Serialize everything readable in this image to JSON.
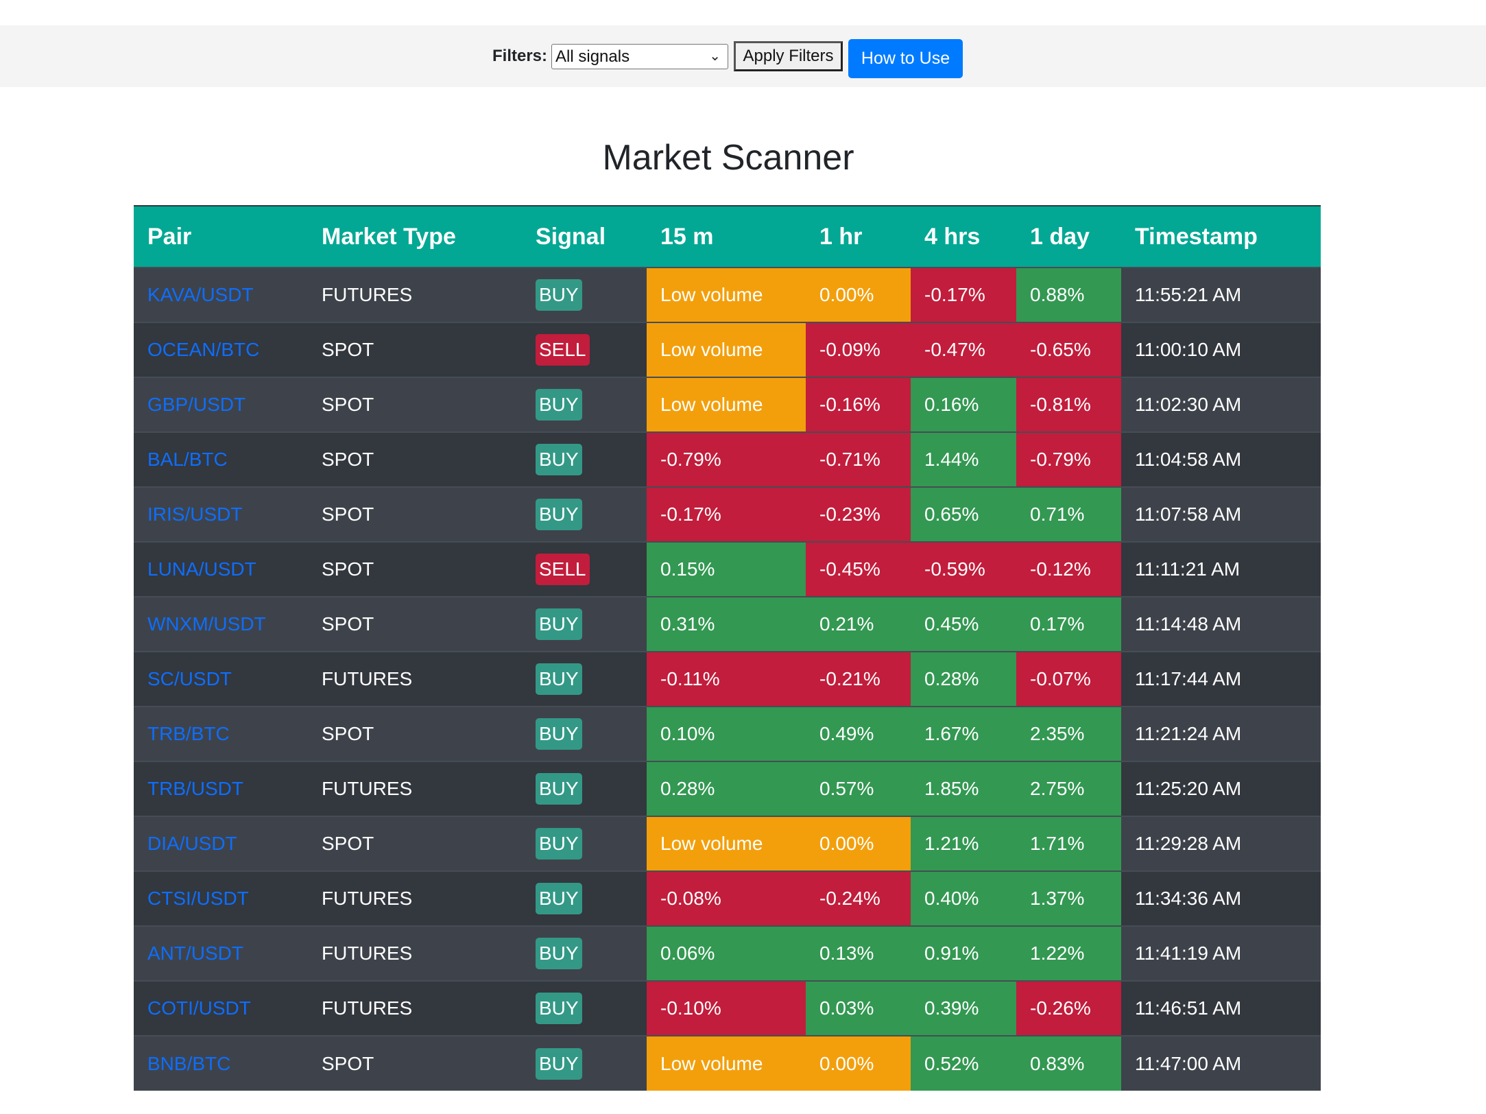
{
  "filter_bar": {
    "label": "Filters:",
    "select_value": "All signals",
    "apply_label": "Apply Filters",
    "howto_label": "How to Use"
  },
  "title": "Market Scanner",
  "colors": {
    "header": "#02a894",
    "positive": "#339852",
    "negative": "#c21d3c",
    "low_volume": "#f39f0c",
    "buy_badge": "#339986",
    "sell_badge": "#c21d3c",
    "link": "#0d6efd",
    "primary_button": "#007bff"
  },
  "table": {
    "columns": [
      "Pair",
      "Market Type",
      "Signal",
      "15 m",
      "1 hr",
      "4 hrs",
      "1 day",
      "Timestamp"
    ],
    "rows": [
      {
        "pair": "KAVA/USDT",
        "market": "FUTURES",
        "signal": "BUY",
        "m15": "Low volume",
        "h1": "0.00%",
        "h4": "-0.17%",
        "d1": "0.88%",
        "ts": "11:55:21 AM",
        "c": [
          "low",
          "low",
          "neg",
          "pos"
        ]
      },
      {
        "pair": "OCEAN/BTC",
        "market": "SPOT",
        "signal": "SELL",
        "m15": "Low volume",
        "h1": "-0.09%",
        "h4": "-0.47%",
        "d1": "-0.65%",
        "ts": "11:00:10 AM",
        "c": [
          "low",
          "neg",
          "neg",
          "neg"
        ]
      },
      {
        "pair": "GBP/USDT",
        "market": "SPOT",
        "signal": "BUY",
        "m15": "Low volume",
        "h1": "-0.16%",
        "h4": "0.16%",
        "d1": "-0.81%",
        "ts": "11:02:30 AM",
        "c": [
          "low",
          "neg",
          "pos",
          "neg"
        ]
      },
      {
        "pair": "BAL/BTC",
        "market": "SPOT",
        "signal": "BUY",
        "m15": "-0.79%",
        "h1": "-0.71%",
        "h4": "1.44%",
        "d1": "-0.79%",
        "ts": "11:04:58 AM",
        "c": [
          "neg",
          "neg",
          "pos",
          "neg"
        ]
      },
      {
        "pair": "IRIS/USDT",
        "market": "SPOT",
        "signal": "BUY",
        "m15": "-0.17%",
        "h1": "-0.23%",
        "h4": "0.65%",
        "d1": "0.71%",
        "ts": "11:07:58 AM",
        "c": [
          "neg",
          "neg",
          "pos",
          "pos"
        ]
      },
      {
        "pair": "LUNA/USDT",
        "market": "SPOT",
        "signal": "SELL",
        "m15": "0.15%",
        "h1": "-0.45%",
        "h4": "-0.59%",
        "d1": "-0.12%",
        "ts": "11:11:21 AM",
        "c": [
          "pos",
          "neg",
          "neg",
          "neg"
        ]
      },
      {
        "pair": "WNXM/USDT",
        "market": "SPOT",
        "signal": "BUY",
        "m15": "0.31%",
        "h1": "0.21%",
        "h4": "0.45%",
        "d1": "0.17%",
        "ts": "11:14:48 AM",
        "c": [
          "pos",
          "pos",
          "pos",
          "pos"
        ]
      },
      {
        "pair": "SC/USDT",
        "market": "FUTURES",
        "signal": "BUY",
        "m15": "-0.11%",
        "h1": "-0.21%",
        "h4": "0.28%",
        "d1": "-0.07%",
        "ts": "11:17:44 AM",
        "c": [
          "neg",
          "neg",
          "pos",
          "neg"
        ]
      },
      {
        "pair": "TRB/BTC",
        "market": "SPOT",
        "signal": "BUY",
        "m15": "0.10%",
        "h1": "0.49%",
        "h4": "1.67%",
        "d1": "2.35%",
        "ts": "11:21:24 AM",
        "c": [
          "pos",
          "pos",
          "pos",
          "pos"
        ]
      },
      {
        "pair": "TRB/USDT",
        "market": "FUTURES",
        "signal": "BUY",
        "m15": "0.28%",
        "h1": "0.57%",
        "h4": "1.85%",
        "d1": "2.75%",
        "ts": "11:25:20 AM",
        "c": [
          "pos",
          "pos",
          "pos",
          "pos"
        ]
      },
      {
        "pair": "DIA/USDT",
        "market": "SPOT",
        "signal": "BUY",
        "m15": "Low volume",
        "h1": "0.00%",
        "h4": "1.21%",
        "d1": "1.71%",
        "ts": "11:29:28 AM",
        "c": [
          "low",
          "low",
          "pos",
          "pos"
        ]
      },
      {
        "pair": "CTSI/USDT",
        "market": "FUTURES",
        "signal": "BUY",
        "m15": "-0.08%",
        "h1": "-0.24%",
        "h4": "0.40%",
        "d1": "1.37%",
        "ts": "11:34:36 AM",
        "c": [
          "neg",
          "neg",
          "pos",
          "pos"
        ]
      },
      {
        "pair": "ANT/USDT",
        "market": "FUTURES",
        "signal": "BUY",
        "m15": "0.06%",
        "h1": "0.13%",
        "h4": "0.91%",
        "d1": "1.22%",
        "ts": "11:41:19 AM",
        "c": [
          "pos",
          "pos",
          "pos",
          "pos"
        ]
      },
      {
        "pair": "COTI/USDT",
        "market": "FUTURES",
        "signal": "BUY",
        "m15": "-0.10%",
        "h1": "0.03%",
        "h4": "0.39%",
        "d1": "-0.26%",
        "ts": "11:46:51 AM",
        "c": [
          "neg",
          "pos",
          "pos",
          "neg"
        ]
      },
      {
        "pair": "BNB/BTC",
        "market": "SPOT",
        "signal": "BUY",
        "m15": "Low volume",
        "h1": "0.00%",
        "h4": "0.52%",
        "d1": "0.83%",
        "ts": "11:47:00 AM",
        "c": [
          "low",
          "low",
          "pos",
          "pos"
        ]
      }
    ]
  }
}
